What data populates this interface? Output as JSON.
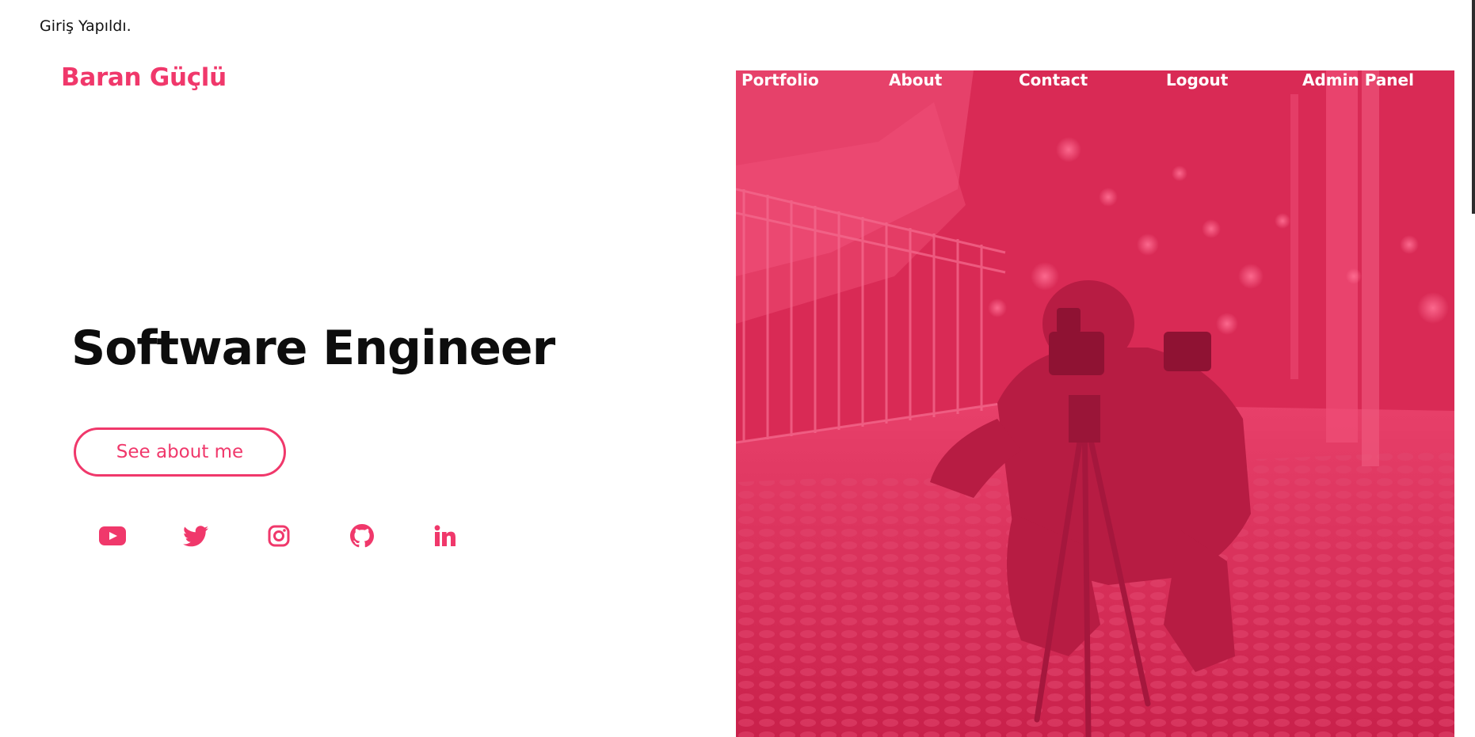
{
  "status_message": "Giriş Yapıldı.",
  "brand": {
    "name": "Baran Güçlü"
  },
  "nav": {
    "items": [
      {
        "label": "Portfolio"
      },
      {
        "label": "About"
      },
      {
        "label": "Contact"
      },
      {
        "label": "Logout"
      },
      {
        "label": "Admin Panel"
      }
    ]
  },
  "hero": {
    "title": "Software Engineer",
    "cta_label": "See about me"
  },
  "socials": [
    {
      "icon": "youtube-icon"
    },
    {
      "icon": "twitter-icon"
    },
    {
      "icon": "instagram-icon"
    },
    {
      "icon": "github-icon"
    },
    {
      "icon": "linkedin-icon"
    }
  ],
  "colors": {
    "accent": "#f0386b",
    "overlay": "#d92a55",
    "text": "#0d0d0d",
    "background": "#ffffff"
  }
}
